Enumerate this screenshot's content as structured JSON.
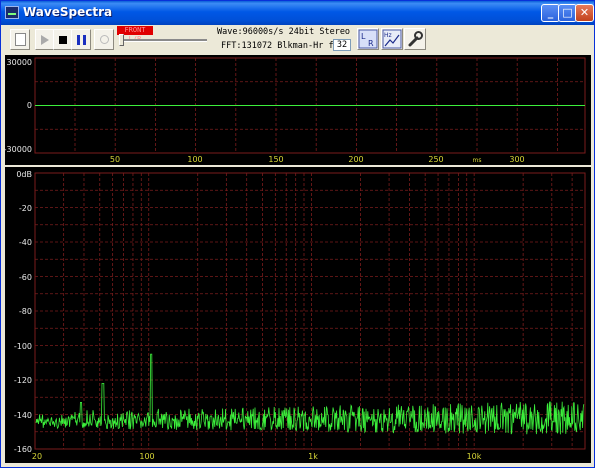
{
  "window": {
    "title": "WaveSpectra"
  },
  "toolbar": {
    "rec_tag": "FRONT L/R",
    "wave_info": "Wave:96000s/s 24bit Stereo",
    "fft_info": "FFT:131072 Blkman-Hr fps:",
    "fps_value": "32",
    "lr_label": "L R",
    "hz_label": "Hz"
  },
  "waveform": {
    "y_ticks": [
      "30000",
      "0",
      "-30000"
    ],
    "x_ticks": [
      "50",
      "100",
      "150",
      "200",
      "250",
      "300"
    ],
    "x_unit": "ms"
  },
  "spectrum": {
    "y_ticks": [
      "0dB",
      "-20",
      "-40",
      "-60",
      "-80",
      "-100",
      "-120",
      "-140",
      "-160"
    ],
    "x_ticks": [
      "20",
      "100",
      "1k",
      "10k"
    ]
  },
  "colors": {
    "background": "#000000",
    "grid": "#7a1c1c",
    "trace": "#3cf03c",
    "axis_text": "#e8e8e8",
    "x_axis_text": "#d8d838"
  }
}
